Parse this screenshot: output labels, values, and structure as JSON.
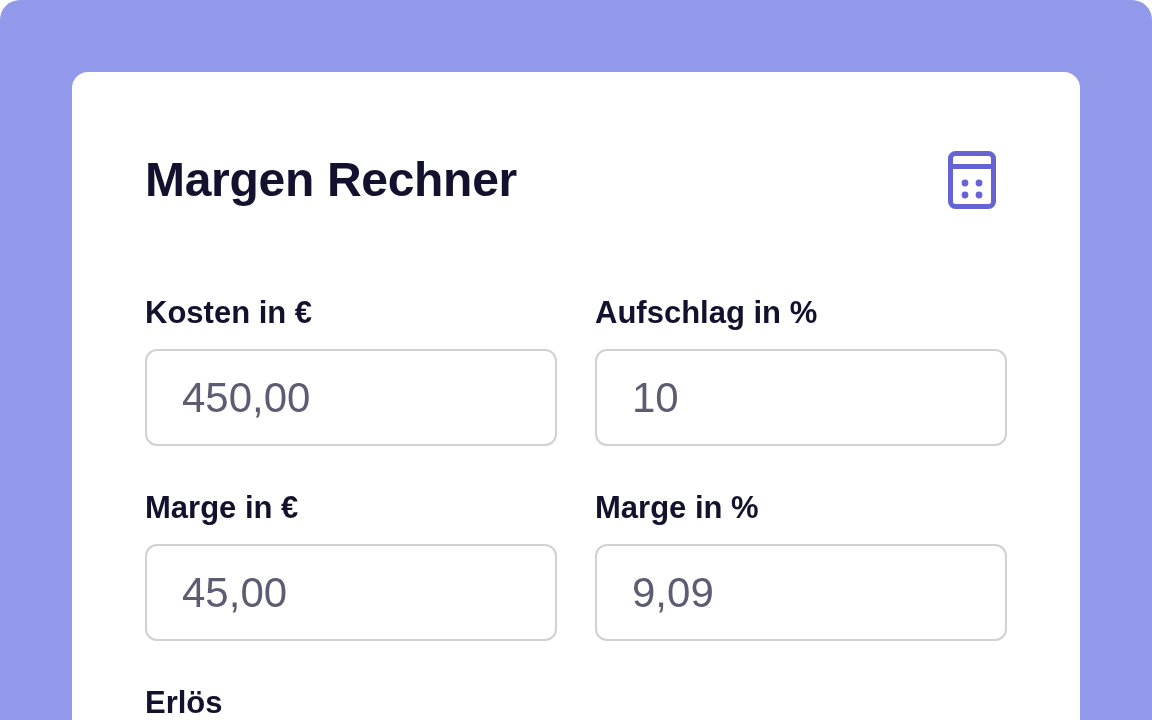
{
  "card": {
    "title": "Margen Rechner",
    "fields": [
      {
        "label": "Kosten in €",
        "value": "450,00"
      },
      {
        "label": "Aufschlag in %",
        "value": "10"
      },
      {
        "label": "Marge in €",
        "value": "45,00"
      },
      {
        "label": "Marge in %",
        "value": "9,09"
      },
      {
        "label": "Erlös"
      }
    ]
  }
}
